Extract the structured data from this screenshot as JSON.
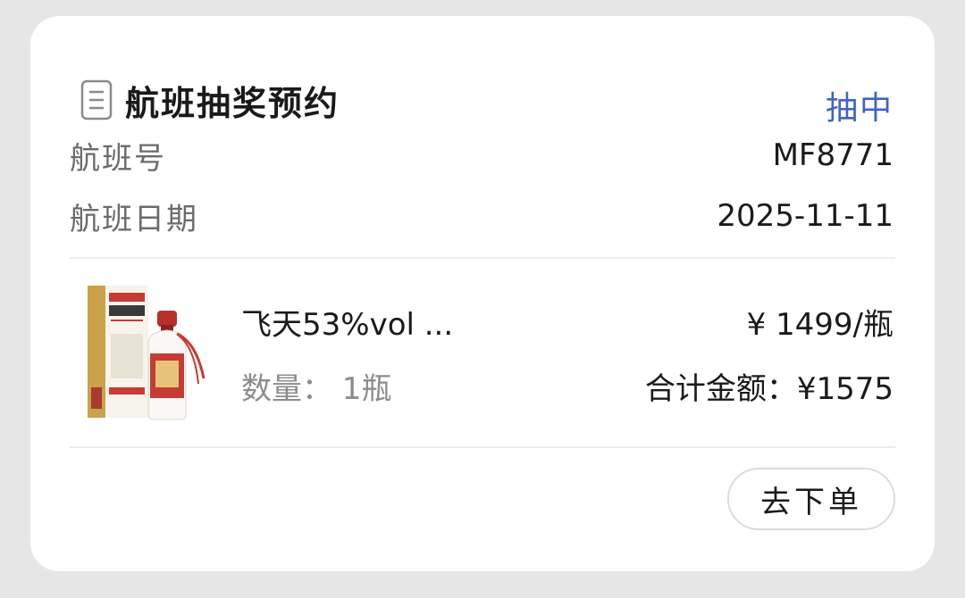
{
  "card": {
    "title": "航班抽奖预约",
    "status": "抽中",
    "status_color": "#3f63c7",
    "icon": "document-icon"
  },
  "flight": {
    "number_label": "航班号",
    "number_value": "MF8771",
    "date_label": "航班日期",
    "date_value": "2025-11-11"
  },
  "product": {
    "image": "liquor-bottle-with-box",
    "name": "飞天53%vol ...",
    "quantity": "数量：  1瓶",
    "unit_price": "¥ 1499/瓶",
    "total": "合计金额：¥1575"
  },
  "actions": {
    "order_label": "去下单"
  }
}
